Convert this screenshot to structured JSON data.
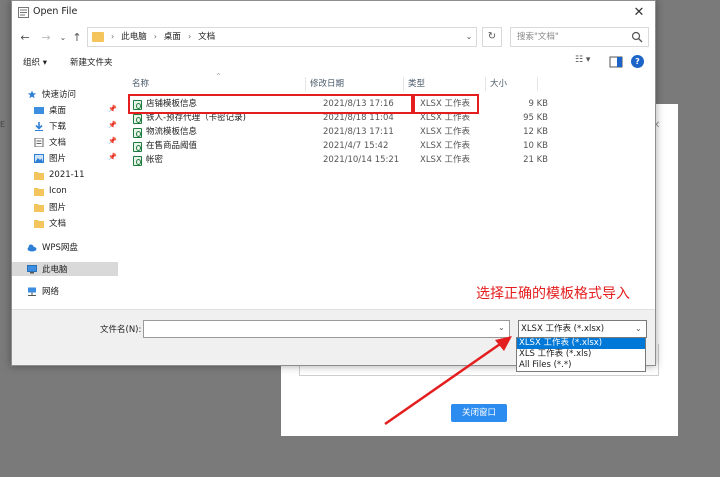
{
  "window": {
    "title": "Open File",
    "close": "✕"
  },
  "nav": {
    "back": "←",
    "forward": "→",
    "dropdown": "⌄",
    "up": "↑"
  },
  "address": {
    "crumbs": [
      "此电脑",
      "桌面",
      "文档"
    ],
    "separator": "›",
    "dropdown": "⌄",
    "refresh": "↻"
  },
  "search": {
    "placeholder": "搜索\"文档\""
  },
  "toolbar": {
    "organize": "组织 ▾",
    "new_folder": "新建文件夹",
    "view": "☷ ▾",
    "help": "?"
  },
  "sidebar": {
    "items": [
      {
        "label": "快速访问",
        "icon": "star-icon",
        "pinned": false
      },
      {
        "label": "桌面",
        "icon": "desktop-folder-icon",
        "pinned": true
      },
      {
        "label": "下载",
        "icon": "download-icon",
        "pinned": true
      },
      {
        "label": "文档",
        "icon": "documents-icon",
        "pinned": true
      },
      {
        "label": "图片",
        "icon": "pictures-icon",
        "pinned": true
      },
      {
        "label": "2021-11",
        "icon": "folder-icon",
        "pinned": false
      },
      {
        "label": "Icon",
        "icon": "folder-icon",
        "pinned": false
      },
      {
        "label": "图片",
        "icon": "folder-icon",
        "pinned": false
      },
      {
        "label": "文档",
        "icon": "folder-icon",
        "pinned": false
      },
      {
        "label": "WPS网盘",
        "icon": "cloud-icon",
        "pinned": false
      },
      {
        "label": "此电脑",
        "icon": "computer-icon",
        "pinned": false
      },
      {
        "label": "网络",
        "icon": "network-icon",
        "pinned": false
      }
    ]
  },
  "columns": {
    "name": "名称",
    "date": "修改日期",
    "type": "类型",
    "size": "大小",
    "sort": "^"
  },
  "files": [
    {
      "name": "店铺模板信息",
      "date": "2021/8/13 17:16",
      "type": "XLSX 工作表",
      "size": "9 KB"
    },
    {
      "name": "铁人-预存代理（卡密记录)",
      "date": "2021/8/18 11:04",
      "type": "XLSX 工作表",
      "size": "95 KB"
    },
    {
      "name": "物流模板信息",
      "date": "2021/8/13 17:11",
      "type": "XLSX 工作表",
      "size": "12 KB"
    },
    {
      "name": "在售商品阈值",
      "date": "2021/4/7 15:42",
      "type": "XLSX 工作表",
      "size": "10 KB"
    },
    {
      "name": "帐密",
      "date": "2021/10/14 15:21",
      "type": "XLSX 工作表",
      "size": "21 KB"
    }
  ],
  "bottom": {
    "filename_label": "文件名(N):",
    "filename_value": "",
    "filetype_selected": "XLSX 工作表 (*.xlsx)",
    "filetype_options": [
      "XLSX 工作表 (*.xlsx)",
      "XLS 工作表 (*.xls)",
      "All Files (*.*)"
    ]
  },
  "annotation": "选择正确的模板格式导入",
  "background_dialog": {
    "close_button": "关闭窗口",
    "close_x": "✕",
    "side_glyph": "E"
  },
  "colors": {
    "accent_red": "#e41e1e",
    "select_blue": "#0078d7",
    "button_blue": "#2d8cf0"
  }
}
